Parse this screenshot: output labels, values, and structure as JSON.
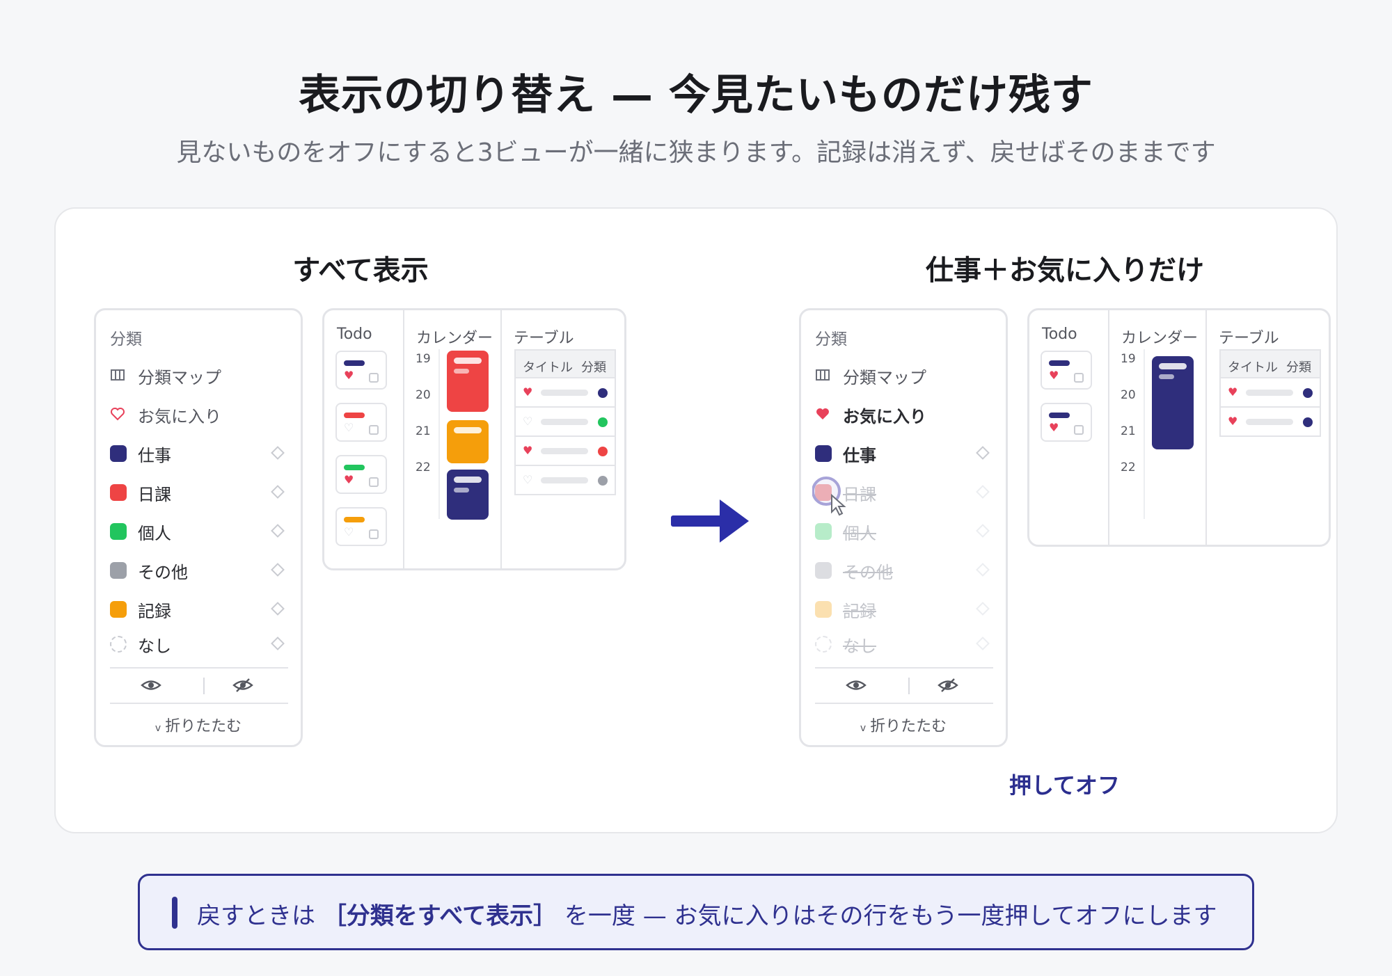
{
  "title": "表示の切り替え — 今見たいものだけ残す",
  "subtitle": "見ないものをオフにすると3ビューが一緒に狭まります。記録は消えず、戻せばそのままです",
  "left_section": {
    "heading": "すべて表示",
    "sidebar": {
      "title": "分類",
      "map_label": "分類マップ",
      "favorites_label": "お気に入り",
      "categories": [
        {
          "label": "仕事",
          "color": "#2f2e7c"
        },
        {
          "label": "日課",
          "color": "#ee4444"
        },
        {
          "label": "個人",
          "color": "#22c55e"
        },
        {
          "label": "その他",
          "color": "#9ca0a8"
        },
        {
          "label": "記録",
          "color": "#f59e0b"
        },
        {
          "label": "なし",
          "color": "none"
        }
      ],
      "collapse_label": "折りたたむ",
      "collapse_chevron": "v"
    },
    "views": {
      "todo_header": "Todo",
      "calendar_header": "カレンダー",
      "table_header": "テーブル",
      "calendar_days": [
        "19",
        "20",
        "21",
        "22"
      ],
      "table_cols": [
        "タイトル",
        "分類"
      ]
    }
  },
  "right_section": {
    "heading": "仕事＋お気に入りだけ",
    "sidebar": {
      "title": "分類",
      "map_label": "分類マップ",
      "favorites_label": "お気に入り",
      "categories": [
        {
          "label": "仕事",
          "color": "#2f2e7c"
        },
        {
          "label": "日課",
          "color": "#f7b5b5"
        },
        {
          "label": "個人",
          "color": "#b7ecc9"
        },
        {
          "label": "その他",
          "color": "#dcdde1"
        },
        {
          "label": "記録",
          "color": "#fbe0b0"
        },
        {
          "label": "なし",
          "color": "none"
        }
      ],
      "collapse_label": "折りたたむ",
      "collapse_chevron": "v"
    },
    "views": {
      "todo_header": "Todo",
      "calendar_header": "カレンダー",
      "table_header": "テーブル",
      "calendar_days": [
        "19",
        "20",
        "21",
        "22"
      ],
      "table_cols": [
        "タイトル",
        "分類"
      ]
    },
    "push_label": "押してオフ"
  },
  "note": {
    "prefix": "戻すときは",
    "highlight": "［分類をすべて表示］",
    "suffix": "を一度 — お気に入りはその行をもう一度押してオフにします"
  },
  "colors": {
    "accent": "#2f318f",
    "heart": "#e8415a",
    "work": "#2f2e7c",
    "routine": "#ee4444",
    "personal": "#22c55e",
    "other": "#9ca0a8",
    "record": "#f59e0b"
  }
}
